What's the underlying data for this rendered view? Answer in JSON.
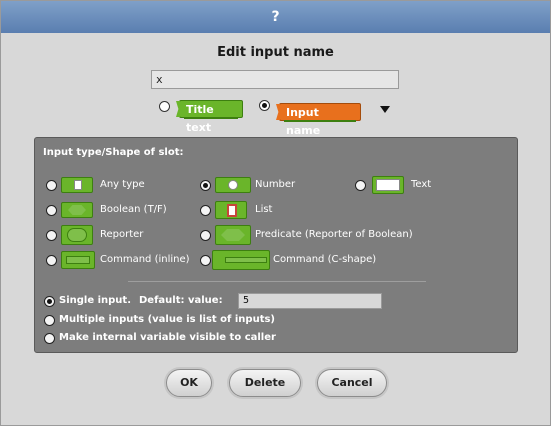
{
  "dialog": {
    "title": "?",
    "heading": "Edit input name",
    "name_value": "x",
    "kind_options": {
      "title_text": "Title text",
      "input_name": "Input name",
      "selected": "input_name"
    },
    "slot_section_label": "Input type/Shape of slot:",
    "slot_types": [
      {
        "label": "Any type",
        "selected": false
      },
      {
        "label": "Number",
        "selected": true
      },
      {
        "label": "Text",
        "selected": false
      },
      {
        "label": "Boolean (T/F)",
        "selected": false
      },
      {
        "label": "List",
        "selected": false
      },
      {
        "label": "Reporter",
        "selected": false
      },
      {
        "label": "Predicate (Reporter of Boolean)",
        "selected": false
      },
      {
        "label": "Command (inline)",
        "selected": false
      },
      {
        "label": "Command (C-shape)",
        "selected": false
      }
    ],
    "single_input_label": "Single input.",
    "default_label": "Default: value:",
    "default_value": "5",
    "multiple_inputs_label": "Multiple inputs (value is list of inputs)",
    "make_visible_label": "Make internal variable visible to caller",
    "buttons": {
      "ok": "OK",
      "delete": "Delete",
      "cancel": "Cancel"
    },
    "colors": {
      "titlebar": "#6a8cbc",
      "panel": "#7d7d7d",
      "green_block": "#6ab52a",
      "orange_block": "#e8701d"
    }
  }
}
